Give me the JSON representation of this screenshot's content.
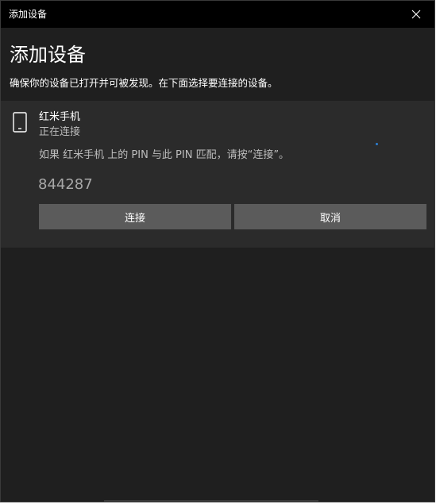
{
  "window": {
    "title": "添加设备"
  },
  "header": {
    "heading": "添加设备",
    "instruction": "确保你的设备已打开并可被发现。在下面选择要连接的设备。"
  },
  "device": {
    "icon": "phone-icon",
    "name": "红米手机",
    "status": "正在连接",
    "pin_prompt": "如果 红米手机 上的 PIN 与此 PIN 匹配，请按“连接”。",
    "pin": "844287"
  },
  "actions": {
    "connect_label": "连接",
    "cancel_label": "取消"
  },
  "colors": {
    "background": "#1f1f1f",
    "titlebar": "#000000",
    "panel": "#2b2b2b",
    "button": "#5b5b5b",
    "accent": "#2b7fd4"
  }
}
